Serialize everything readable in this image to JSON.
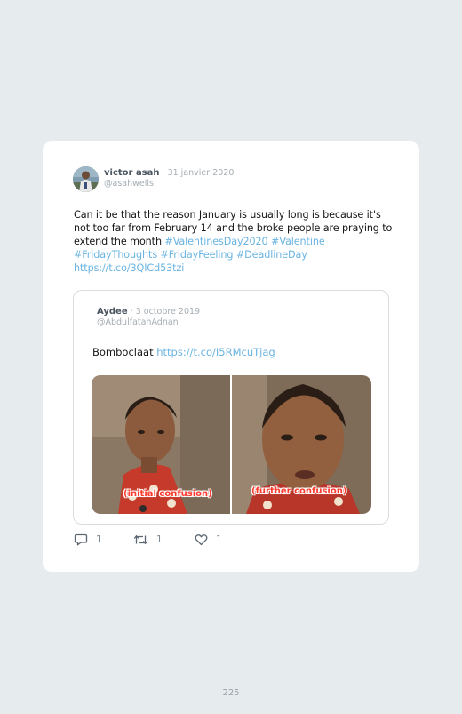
{
  "tweet": {
    "author_name": "victor asah",
    "separator": " · ",
    "date": "31 janvier 2020",
    "handle": "@asahwells",
    "text": "Can it be that the reason January is usually long is because it's not too far from February 14 and the broke people are praying to extend the month ",
    "hashtags": [
      "#ValentinesDay2020",
      "#Valentine",
      "#FridayThoughts",
      "#FridayFeeling",
      "#DeadlineDay"
    ],
    "link": "https://t.co/3QICd53tzi"
  },
  "quoted": {
    "author_name": "Aydee",
    "separator": " · ",
    "date": "3 octobre 2019",
    "handle": "@AbdulfatahAdnan",
    "text": "Bomboclaat ",
    "link": "https://t.co/I5RMcuTjag",
    "media": {
      "left_caption": "(initial confusion)",
      "right_caption": "(further confusion)"
    }
  },
  "actions": {
    "reply_icon": "reply-icon",
    "reply_count": "1",
    "retweet_icon": "retweet-icon",
    "retweet_count": "1",
    "like_icon": "heart-icon",
    "like_count": "1"
  },
  "page_number": "225",
  "colors": {
    "background": "#e6ebee",
    "card": "#ffffff",
    "link": "#6ab4e2",
    "caption": "#ff3b2f"
  }
}
